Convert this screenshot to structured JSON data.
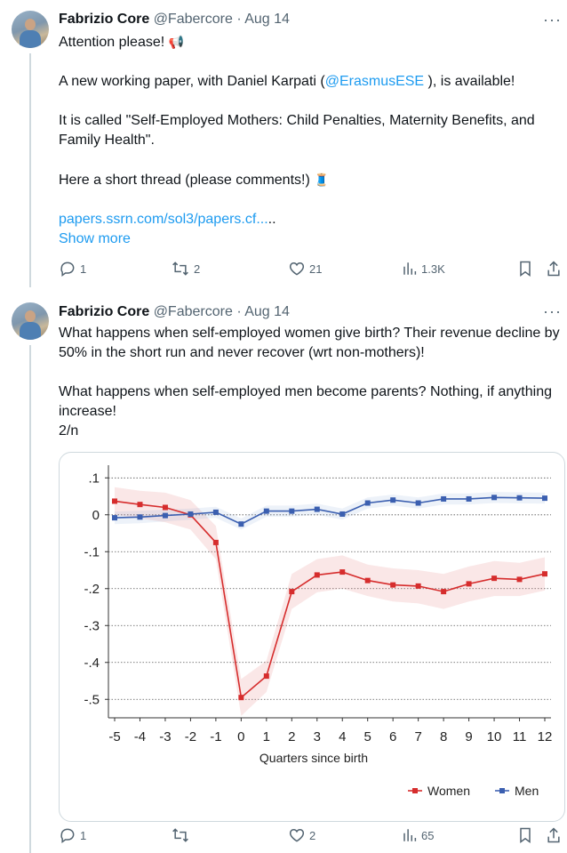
{
  "tweet1": {
    "name": "Fabrizio Core",
    "handle": "@Fabercore",
    "dot": "·",
    "date": "Aug 14",
    "more": "···",
    "line1": "Attention please! ",
    "line1_emoji": "📢",
    "line2_pre": "A new working paper, with Daniel Karpati (",
    "line2_link": "@ErasmusESE",
    "line2_post": " ), is available!",
    "line3": "It is called \"Self-Employed Mothers: Child Penalties, Maternity Benefits, and Family Health\".",
    "line4": "Here a short thread (please comments!) ",
    "line4_emoji": "🧵",
    "url": "papers.ssrn.com/sol3/papers.cf...",
    "url_tail": "..",
    "show_more": "Show more",
    "replies": "1",
    "retweets": "2",
    "likes": "21",
    "views": "1.3K"
  },
  "tweet2": {
    "name": "Fabrizio Core",
    "handle": "@Fabercore",
    "dot": "·",
    "date": "Aug 14",
    "more": "···",
    "line1": "What happens when self-employed women give birth? Their revenue decline by 50% in the short run and never recover (wrt non-mothers)!",
    "line2": "What happens when self-employed men become parents? Nothing, if anything increase!",
    "line3": "2/n",
    "replies": "1",
    "retweets": "",
    "likes": "2",
    "views": "65"
  },
  "chart_data": {
    "type": "line",
    "xlabel": "Quarters since birth",
    "ylabel": "",
    "x": [
      -5,
      -4,
      -3,
      -2,
      -1,
      0,
      1,
      2,
      3,
      4,
      5,
      6,
      7,
      8,
      9,
      10,
      11,
      12
    ],
    "ylim": [
      -0.55,
      0.12
    ],
    "yticks": [
      0.1,
      0,
      -0.1,
      -0.2,
      -0.3,
      -0.4,
      -0.5
    ],
    "ytick_labels": [
      ".1",
      "0",
      "-.1",
      "-.2",
      "-.3",
      "-.4",
      "-.5"
    ],
    "grid": true,
    "legend_position": "bottom-right",
    "series": [
      {
        "name": "Women",
        "color": "#d62d2d",
        "values": [
          0.037,
          0.028,
          0.02,
          0.0,
          -0.075,
          -0.495,
          -0.437,
          -0.208,
          -0.163,
          -0.155,
          -0.178,
          -0.19,
          -0.193,
          -0.208,
          -0.187,
          -0.172,
          -0.175,
          -0.16
        ],
        "lower": [
          0.0,
          -0.01,
          -0.02,
          -0.04,
          -0.12,
          -0.545,
          -0.48,
          -0.255,
          -0.21,
          -0.2,
          -0.22,
          -0.235,
          -0.24,
          -0.255,
          -0.235,
          -0.22,
          -0.22,
          -0.205
        ],
        "upper": [
          0.075,
          0.065,
          0.06,
          0.04,
          -0.03,
          -0.445,
          -0.395,
          -0.16,
          -0.12,
          -0.11,
          -0.135,
          -0.145,
          -0.15,
          -0.16,
          -0.14,
          -0.125,
          -0.13,
          -0.115
        ]
      },
      {
        "name": "Men",
        "color": "#3b5fb0",
        "values": [
          -0.008,
          -0.006,
          -0.002,
          0.002,
          0.007,
          -0.025,
          0.01,
          0.01,
          0.015,
          0.002,
          0.032,
          0.04,
          0.032,
          0.043,
          0.043,
          0.047,
          0.046,
          0.045
        ],
        "lower": [
          -0.025,
          -0.023,
          -0.018,
          -0.013,
          -0.008,
          -0.04,
          -0.005,
          -0.005,
          0.0,
          -0.013,
          0.017,
          0.025,
          0.017,
          0.028,
          0.028,
          0.032,
          0.031,
          0.03
        ],
        "upper": [
          0.009,
          0.011,
          0.014,
          0.017,
          0.022,
          -0.01,
          0.025,
          0.025,
          0.03,
          0.017,
          0.047,
          0.055,
          0.047,
          0.058,
          0.058,
          0.062,
          0.061,
          0.06
        ]
      }
    ]
  }
}
